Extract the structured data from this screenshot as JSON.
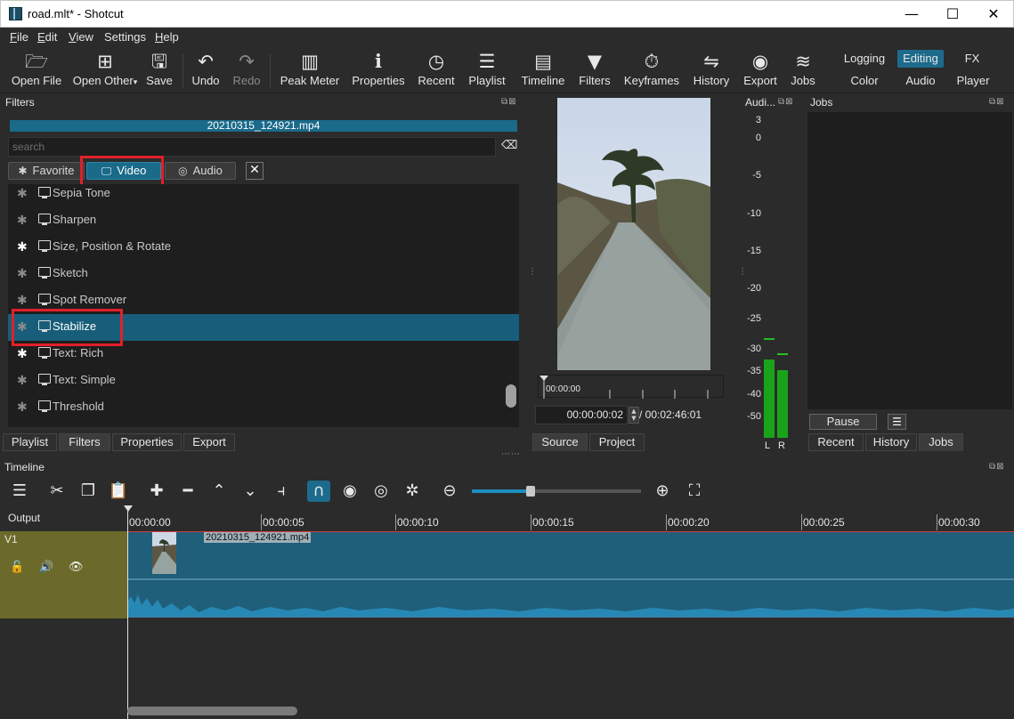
{
  "window": {
    "title": "road.mlt* - Shotcut",
    "minimize": "—",
    "maximize": "☐",
    "close": "✕"
  },
  "menu": [
    {
      "u": "F",
      "rest": "ile"
    },
    {
      "u": "E",
      "rest": "dit"
    },
    {
      "u": "V",
      "rest": "iew"
    },
    {
      "u": "",
      "rest": "Settings"
    },
    {
      "u": "H",
      "rest": "elp"
    }
  ],
  "toolbar": {
    "open_file": "Open File",
    "open_other": "Open Other",
    "save": "Save",
    "undo": "Undo",
    "redo": "Redo",
    "peak_meter": "Peak Meter",
    "properties": "Properties",
    "recent": "Recent",
    "playlist": "Playlist",
    "timeline": "Timeline",
    "filters": "Filters",
    "keyframes": "Keyframes",
    "history": "History",
    "export": "Export",
    "jobs": "Jobs"
  },
  "layouts": {
    "logging": "Logging",
    "editing": "Editing",
    "fx": "FX",
    "color": "Color",
    "audio": "Audio",
    "player": "Player"
  },
  "filters_panel": {
    "title": "Filters",
    "clip_name": "20210315_124921.mp4",
    "search_placeholder": "search",
    "chips": {
      "favorite": "Favorite",
      "video": "Video",
      "audio": "Audio"
    },
    "items": [
      {
        "name": "Sepia Tone",
        "fav": false
      },
      {
        "name": "Sharpen",
        "fav": false
      },
      {
        "name": "Size, Position & Rotate",
        "fav": true
      },
      {
        "name": "Sketch",
        "fav": false
      },
      {
        "name": "Spot Remover",
        "fav": false
      },
      {
        "name": "Stabilize",
        "fav": false
      },
      {
        "name": "Text: Rich",
        "fav": true
      },
      {
        "name": "Text: Simple",
        "fav": false
      },
      {
        "name": "Threshold",
        "fav": false
      }
    ],
    "tabs": {
      "playlist": "Playlist",
      "filters": "Filters",
      "properties": "Properties",
      "export": "Export"
    }
  },
  "player": {
    "ruler_time": "00:00:00",
    "position": "00:00:00:02",
    "duration": "/ 00:02:46:01",
    "tabs": {
      "source": "Source",
      "project": "Project"
    }
  },
  "audio_meter": {
    "title": "Audi...",
    "ticks": [
      "3",
      "0",
      "-5",
      "-10",
      "-15",
      "-20",
      "-25",
      "-30",
      "-35",
      "-40",
      "-50"
    ],
    "left": "L",
    "right": "R"
  },
  "jobs_panel": {
    "title": "Jobs",
    "pause": "Pause",
    "tabs": {
      "recent": "Recent",
      "history": "History",
      "jobs": "Jobs"
    }
  },
  "timeline": {
    "title": "Timeline",
    "output": "Output",
    "track": "V1",
    "clip_name": "20210315_124921.mp4",
    "ruler": [
      "00:00:00",
      "00:00:05",
      "00:00:10",
      "00:00:15",
      "00:00:20",
      "00:00:25",
      "00:00:30"
    ]
  }
}
